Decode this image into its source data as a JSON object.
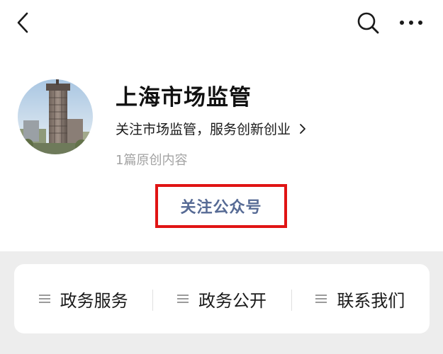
{
  "header": {
    "back_icon": "chevron-left-icon",
    "search_icon": "search-icon",
    "more_icon": "more-dots-icon"
  },
  "profile": {
    "name": "上海市场监管",
    "description": "关注市场监管，服务创新创业",
    "description_chevron": "chevron-right-icon",
    "original_count": "1篇原创内容",
    "follow_label": "关注公众号",
    "highlight_color": "#e01414",
    "follow_color": "#576b95"
  },
  "menu": {
    "items": [
      {
        "label": "政务服务",
        "icon": "menu-lines-icon"
      },
      {
        "label": "政务公开",
        "icon": "menu-lines-icon"
      },
      {
        "label": "联系我们",
        "icon": "menu-lines-icon"
      }
    ]
  }
}
